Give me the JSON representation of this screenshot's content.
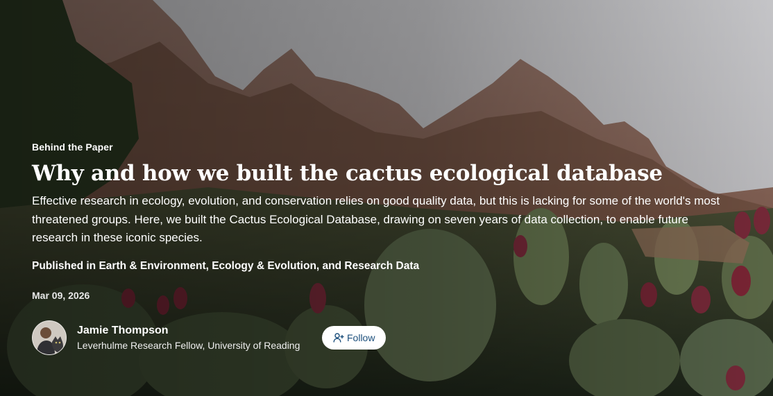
{
  "article": {
    "category": "Behind the Paper",
    "title": "Why and how we built the cactus ecological database",
    "summary": "Effective research in ecology, evolution, and conservation relies on good quality data, but this is lacking for some of the world's most threatened groups. Here, we built the Cactus Ecological Database, drawing on seven years of data collection, to enable future research in these iconic species.",
    "subjects": "Published in Earth & Environment, Ecology & Evolution, and Research Data",
    "date": "Mar 09, 2026"
  },
  "author": {
    "name": "Jamie Thompson",
    "role": "Leverhulme Research Fellow, University of Reading",
    "avatar_icon": "person-with-cat-photo"
  },
  "actions": {
    "follow_label": "Follow",
    "follow_icon": "person-plus-icon"
  },
  "colors": {
    "follow_text": "#1c4f7c",
    "follow_bg": "#ffffff",
    "text": "#ffffff"
  },
  "background": {
    "description_icon": "desert-mountain-cactus-photo"
  }
}
